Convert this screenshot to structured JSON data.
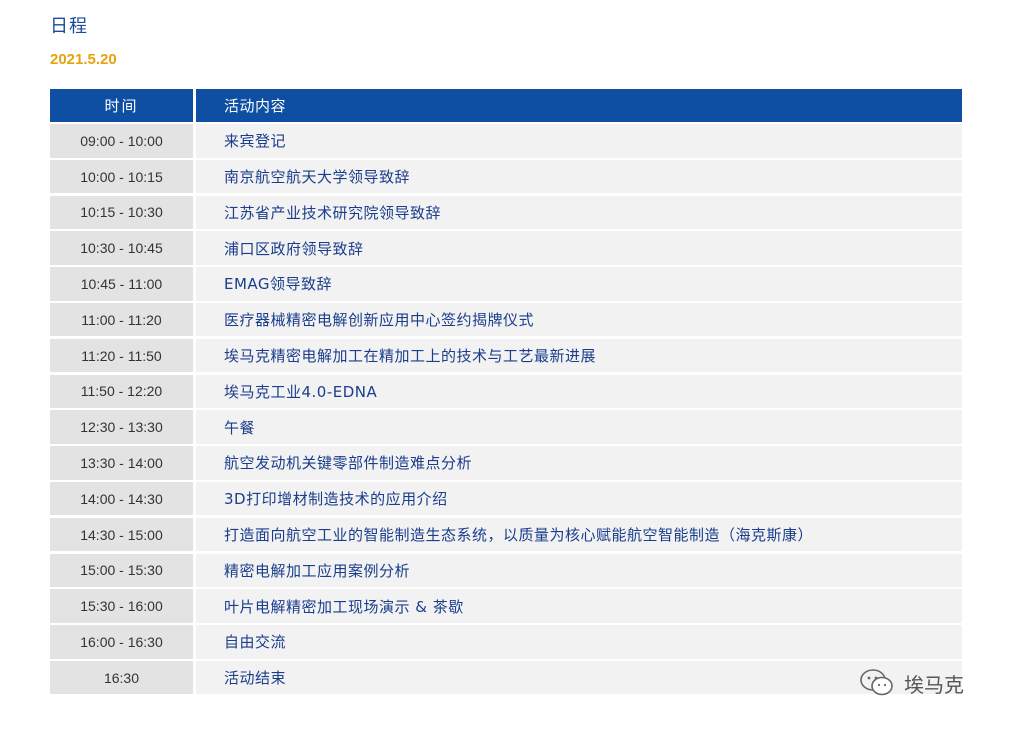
{
  "title": "日程",
  "date": "2021.5.20",
  "table": {
    "headers": {
      "time": "时间",
      "activity": "活动内容"
    },
    "rows": [
      {
        "time": "09:00 - 10:00",
        "activity": "来宾登记"
      },
      {
        "time": "10:00 - 10:15",
        "activity": "南京航空航天大学领导致辞"
      },
      {
        "time": "10:15 - 10:30",
        "activity": "江苏省产业技术研究院领导致辞"
      },
      {
        "time": "10:30 - 10:45",
        "activity": "浦口区政府领导致辞"
      },
      {
        "time": "10:45 - 11:00",
        "activity": "EMAG领导致辞"
      },
      {
        "time": "11:00 - 11:20",
        "activity": "医疗器械精密电解创新应用中心签约揭牌仪式"
      },
      {
        "time": "11:20 - 11:50",
        "activity": "埃马克精密电解加工在精加工上的技术与工艺最新进展"
      },
      {
        "time": "11:50 - 12:20",
        "activity": "埃马克工业4.0-EDNA"
      },
      {
        "time": "12:30 - 13:30",
        "activity": "午餐"
      },
      {
        "time": "13:30 - 14:00",
        "activity": "航空发动机关键零部件制造难点分析"
      },
      {
        "time": "14:00 - 14:30",
        "activity": "3D打印增材制造技术的应用介绍"
      },
      {
        "time": "14:30 - 15:00",
        "activity": "打造面向航空工业的智能制造生态系统，以质量为核心赋能航空智能制造（海克斯康）"
      },
      {
        "time": "15:00 - 15:30",
        "activity": "精密电解加工应用案例分析"
      },
      {
        "time": "15:30 - 16:00",
        "activity": "叶片电解精密加工现场演示 & 茶歇"
      },
      {
        "time": "16:00 - 16:30",
        "activity": "自由交流"
      },
      {
        "time": "16:30",
        "activity": "活动结束"
      }
    ]
  },
  "watermark": {
    "icon": "wechat-icon",
    "text": "埃马克"
  },
  "colors": {
    "header_bg": "#0e4ea3",
    "activity_text": "#1a3d8c",
    "date_text": "#e8a20c",
    "title_text": "#1a4a9c"
  }
}
